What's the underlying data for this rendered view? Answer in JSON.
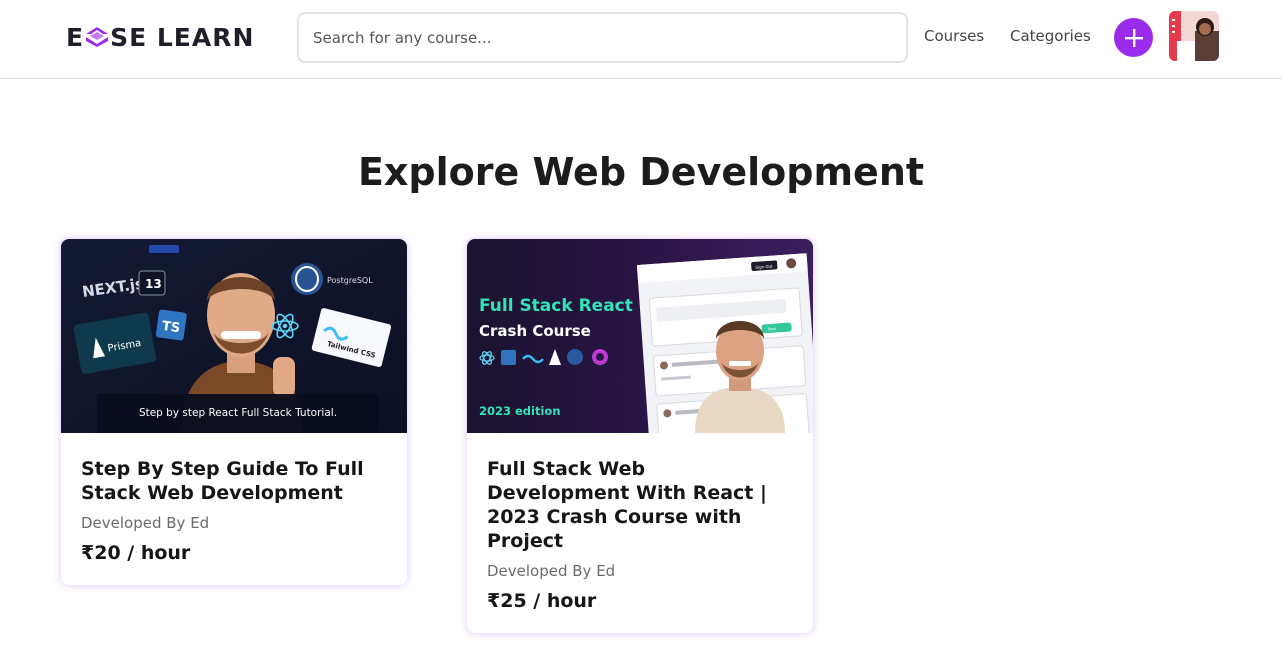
{
  "header": {
    "logo": {
      "prefix": "E",
      "suffix": "SE LEARN"
    },
    "search": {
      "placeholder": "Search for any course...",
      "value": ""
    },
    "nav": {
      "courses": "Courses",
      "categories": "Categories"
    },
    "add_icon": "plus-icon",
    "accent_color": "#9b2bea"
  },
  "main": {
    "title": "Explore Web Development",
    "courses": [
      {
        "thumbnail_caption": "Step by step React Full Stack Tutorial.",
        "thumbnail_logos": [
          "NEXT.js",
          "13",
          "TS",
          "PostgreSQL",
          "Prisma",
          "Tailwind CSS"
        ],
        "title": "Step By Step Guide To Full Stack Web Development",
        "author": "Developed By Ed",
        "price": "₹20 / hour"
      },
      {
        "thumbnail_heading_1": "Full Stack React",
        "thumbnail_heading_2": "Crash Course",
        "thumbnail_edition": "2023 edition",
        "thumbnail_button": "Sign Out",
        "thumbnail_pill": "Post",
        "title": "Full Stack Web Development With React | 2023 Crash Course with Project",
        "author": "Developed By Ed",
        "price": "₹25 / hour"
      }
    ]
  }
}
